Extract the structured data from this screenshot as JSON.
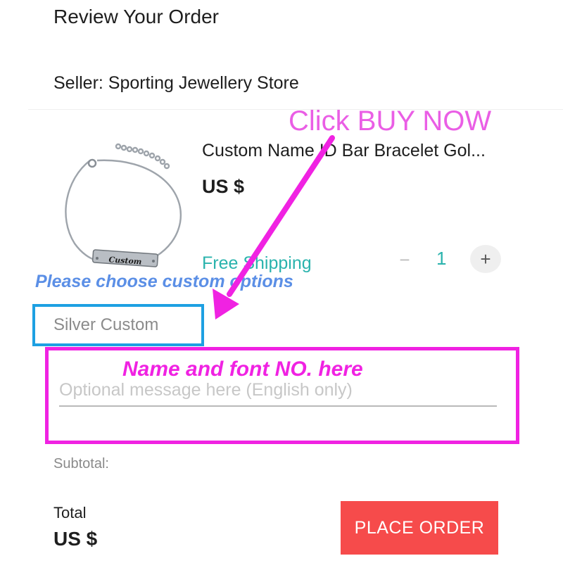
{
  "header": {
    "title": "Review Your Order"
  },
  "seller": {
    "label": "Seller: Sporting Jewellery Store"
  },
  "product": {
    "title": "Custom Name ID Bar Bracelet Gol...",
    "price": "US $",
    "shipping": "Free Shipping",
    "image_engraving": "Custom",
    "quantity": {
      "minus_icon": "minus-icon",
      "value": "1",
      "plus_icon": "plus-icon"
    }
  },
  "variant": {
    "selected": "Silver Custom"
  },
  "message": {
    "placeholder": "Optional message here (English only)"
  },
  "summary": {
    "subtotal_label": "Subtotal:",
    "total_label": "Total",
    "total_value": "US $"
  },
  "actions": {
    "place_order": "PLACE ORDER"
  },
  "annotations": {
    "buy_now": "Click BUY NOW",
    "custom_options": "Please choose custom options",
    "name_font": "Name and font NO. here"
  },
  "colors": {
    "annotation_magenta": "#f022e2",
    "annotation_blue": "#5b8fe6",
    "variant_border": "#1da0e2",
    "shipping_teal": "#2ab3ad",
    "place_order_red": "#f64b4b"
  }
}
